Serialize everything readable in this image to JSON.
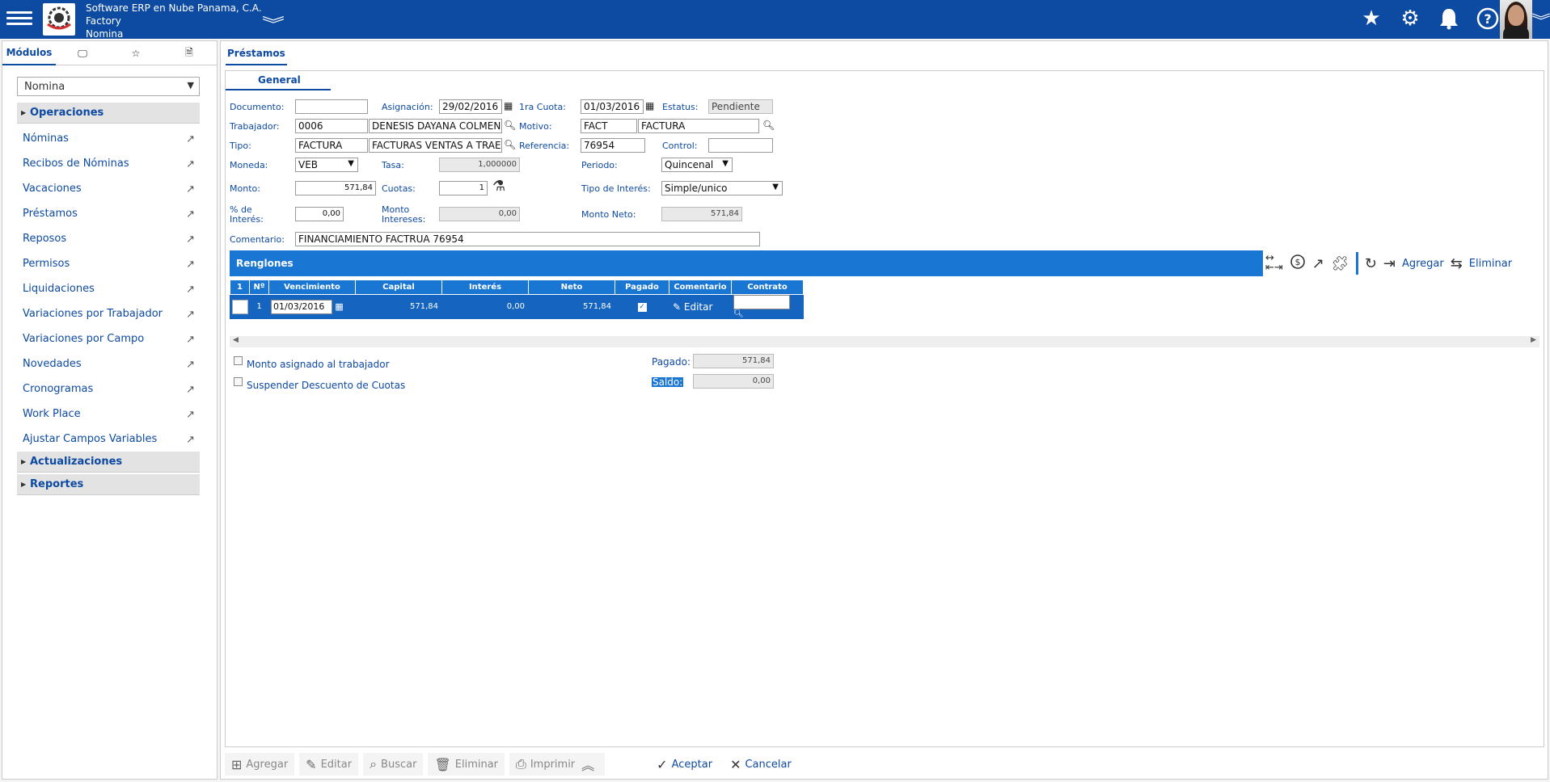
{
  "header": {
    "company": "Software ERP en Nube Panama, C.A.",
    "branch": "Factory",
    "module": "Nomina"
  },
  "sidebar": {
    "tabs": [
      "Módulos"
    ],
    "select_value": "Nomina",
    "sections": [
      "Operaciones",
      "Actualizaciones",
      "Reportes"
    ],
    "items": [
      "Nóminas",
      "Recibos de Nóminas",
      "Vacaciones",
      "Préstamos",
      "Reposos",
      "Permisos",
      "Liquidaciones",
      "Variaciones por Trabajador",
      "Variaciones por Campo",
      "Novedades",
      "Cronogramas",
      "Work Place",
      "Ajustar Campos Variables"
    ]
  },
  "main": {
    "tab": "Préstamos",
    "subtab": "General"
  },
  "form": {
    "documento_label": "Documento:",
    "documento_value": "",
    "asignacion_label": "Asignación:",
    "asignacion_value": "29/02/2016",
    "cuota1_label": "1ra Cuota:",
    "cuota1_value": "01/03/2016",
    "estatus_label": "Estatus:",
    "estatus_value": "Pendiente",
    "trabajador_label": "Trabajador:",
    "trabajador_code": "0006",
    "trabajador_name": "DENESIS DAYANA COLMEN",
    "motivo_label": "Motivo:",
    "motivo_code": "FACT",
    "motivo_name": "FACTURA",
    "tipo_label": "Tipo:",
    "tipo_code": "FACTURA",
    "tipo_name": "FACTURAS VENTAS A TRAE",
    "referencia_label": "Referencia:",
    "referencia_value": "76954",
    "control_label": "Control:",
    "control_value": "",
    "moneda_label": "Moneda:",
    "moneda_value": "VEB",
    "tasa_label": "Tasa:",
    "tasa_value": "1,000000",
    "periodo_label": "Periodo:",
    "periodo_value": "Quincenal",
    "monto_label": "Monto:",
    "monto_value": "571,84",
    "cuotas_label": "Cuotas:",
    "cuotas_value": "1",
    "tipo_interes_label": "Tipo de Interés:",
    "tipo_interes_value": "Simple/unico",
    "pct_interes_label_1": "% de",
    "pct_interes_label_2": "Interés:",
    "pct_interes_value": "0,00",
    "monto_intereses_label_1": "Monto",
    "monto_intereses_label_2": "Intereses:",
    "monto_intereses_value": "0,00",
    "monto_neto_label": "Monto Neto:",
    "monto_neto_value": "571,84",
    "comentario_label": "Comentario:",
    "comentario_value": "FINANCIAMIENTO FACTRUA 76954"
  },
  "renglones": {
    "title": "Renglones",
    "agregar": "Agregar",
    "eliminar": "Eliminar",
    "columns": [
      "1",
      "Nº",
      "Vencimiento",
      "Capital",
      "Interés",
      "Neto",
      "Pagado",
      "Comentario",
      "Contrato"
    ],
    "row": {
      "n": "1",
      "vencimiento": "01/03/2016",
      "capital": "571,84",
      "interes": "0,00",
      "neto": "571,84",
      "pagado": "✓",
      "comentario": "Editar"
    }
  },
  "bottom": {
    "monto_asignado": "Monto asignado al trabajador",
    "suspender": "Suspender Descuento de Cuotas",
    "pagado_label": "Pagado:",
    "pagado_value": "571,84",
    "saldo_label": "Saldo:",
    "saldo_value": "0,00"
  },
  "footer": {
    "agregar": "Agregar",
    "editar": "Editar",
    "buscar": "Buscar",
    "eliminar": "Eliminar",
    "imprimir": "Imprimir",
    "aceptar": "Aceptar",
    "cancelar": "Cancelar"
  },
  "colors": {
    "header_bg": "#0d4aa2",
    "accent": "#1976d2"
  }
}
